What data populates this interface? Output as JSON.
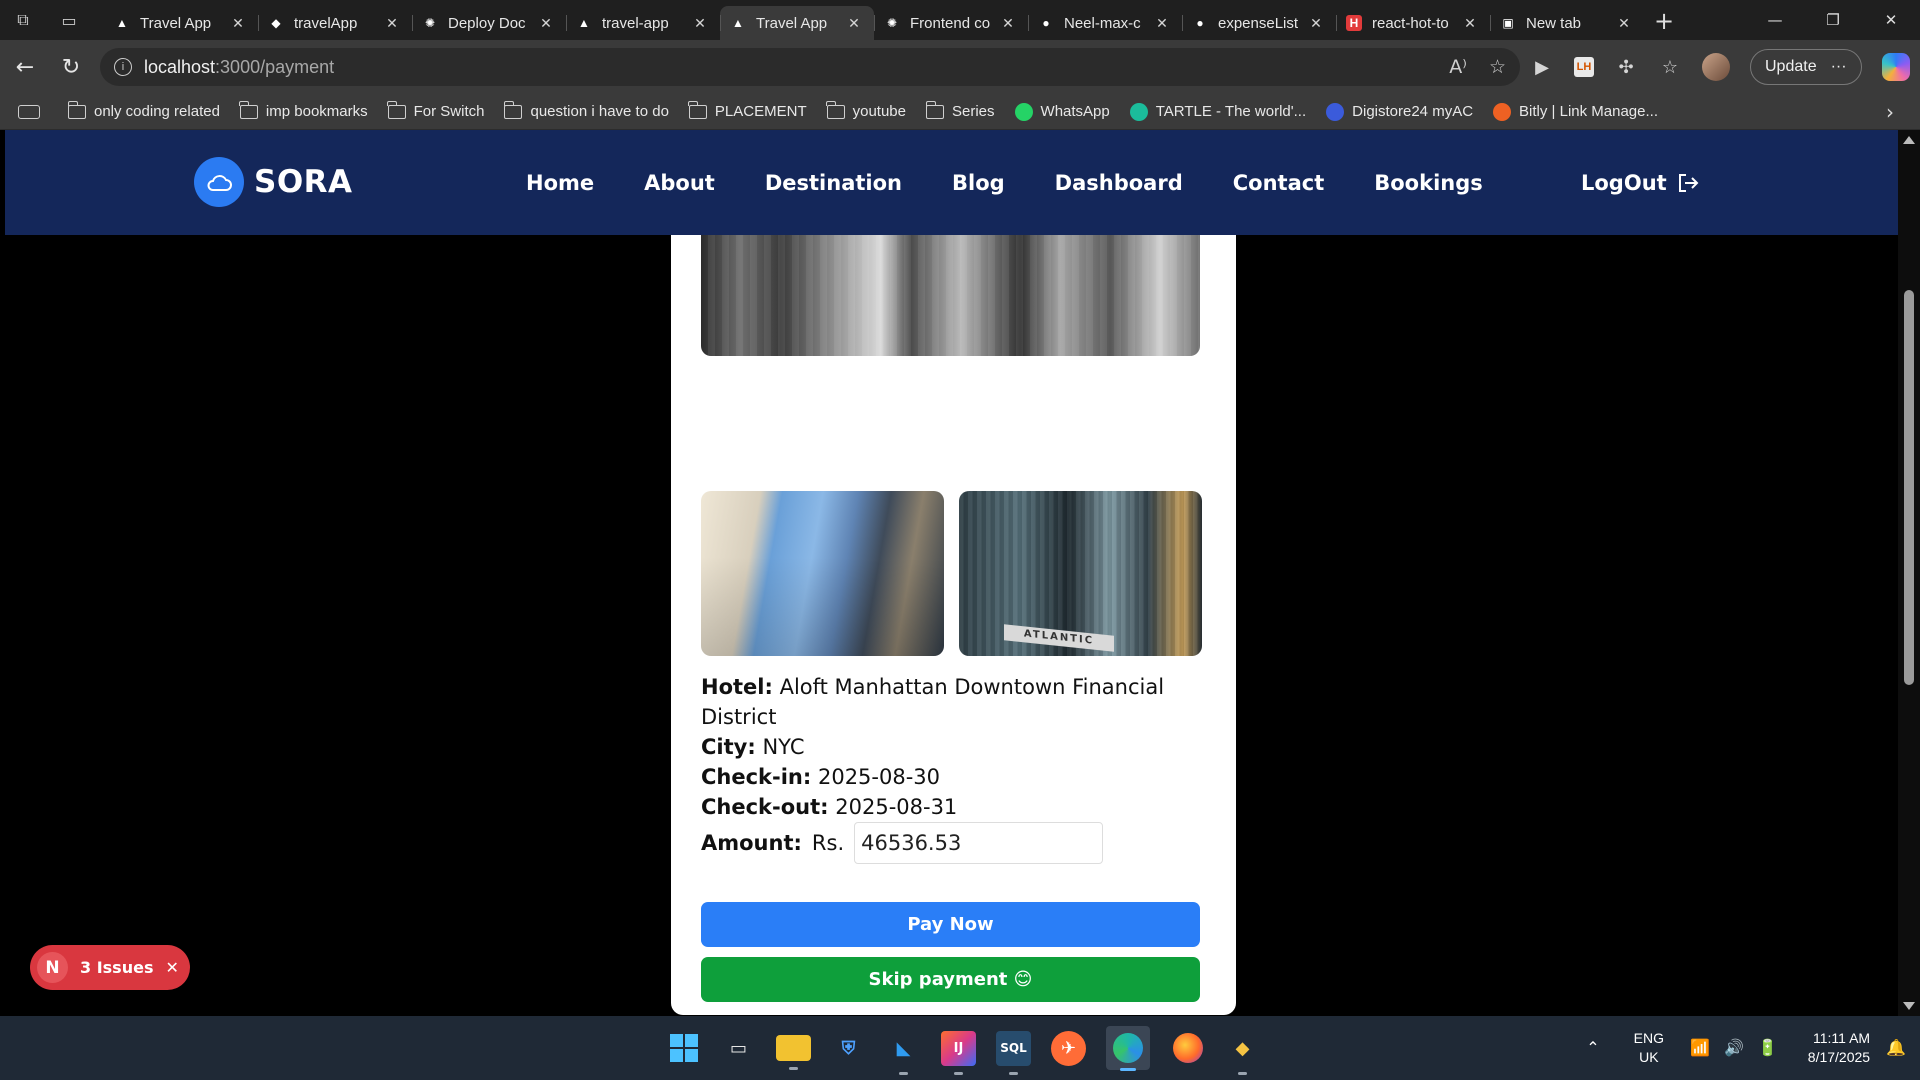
{
  "browser": {
    "tabs": [
      {
        "title": "Travel App",
        "icon": "vercel-icon",
        "active": false
      },
      {
        "title": "travelApp",
        "icon": "render-icon",
        "active": false
      },
      {
        "title": "Deploy Doc",
        "icon": "openai-icon",
        "active": false
      },
      {
        "title": "travel-app",
        "icon": "vercel-icon",
        "active": false
      },
      {
        "title": "Travel App",
        "icon": "vercel-icon",
        "active": true
      },
      {
        "title": "Frontend co",
        "icon": "openai-icon",
        "active": false
      },
      {
        "title": "Neel-max-c",
        "icon": "github-icon",
        "active": false
      },
      {
        "title": "expenseList",
        "icon": "github-icon",
        "active": false
      },
      {
        "title": "react-hot-to",
        "icon": "h-icon",
        "active": false
      },
      {
        "title": "New tab",
        "icon": "newtab-icon",
        "active": false
      }
    ],
    "url_host": "localhost",
    "url_path": ":3000/payment",
    "update_label": "Update",
    "bookmarks": [
      {
        "label": "only coding  related",
        "type": "folder"
      },
      {
        "label": "imp bookmarks",
        "type": "folder"
      },
      {
        "label": "For Switch",
        "type": "folder"
      },
      {
        "label": "question i have to do",
        "type": "folder"
      },
      {
        "label": "PLACEMENT",
        "type": "folder"
      },
      {
        "label": "youtube",
        "type": "folder"
      },
      {
        "label": "Series",
        "type": "folder"
      },
      {
        "label": "WhatsApp",
        "type": "site",
        "color": "#25d366"
      },
      {
        "label": "TARTLE - The world'...",
        "type": "site",
        "color": "#1bbc9b"
      },
      {
        "label": "Digistore24 myAC",
        "type": "site",
        "color": "#3b5bdb"
      },
      {
        "label": "Bitly | Link Manage...",
        "type": "site",
        "color": "#ee6123"
      }
    ]
  },
  "site": {
    "logo_text": "SORA",
    "nav": [
      "Home",
      "About",
      "Destination",
      "Blog",
      "Dashboard",
      "Contact",
      "Bookings"
    ],
    "logout_label": "LogOut",
    "accent_color": "#14275a"
  },
  "booking": {
    "hotel_label": "Hotel:",
    "hotel_value": "Aloft Manhattan Downtown Financial District",
    "city_label": "City:",
    "city_value": "NYC",
    "checkin_label": "Check-in:",
    "checkin_value": "2025-08-30",
    "checkout_label": "Check-out:",
    "checkout_value": "2025-08-31",
    "amount_label": "Amount:",
    "currency": "Rs.",
    "amount_value": "46536.53",
    "pay_label": "Pay Now",
    "skip_label": "Skip payment 😊",
    "photo_sign_text": "ATLANTIC"
  },
  "dev_overlay": {
    "badge_letter": "N",
    "issues_label": "3 Issues"
  },
  "taskbar": {
    "lang_line1": "ENG",
    "lang_line2": "UK",
    "time": "11:11 AM",
    "date": "8/17/2025"
  }
}
